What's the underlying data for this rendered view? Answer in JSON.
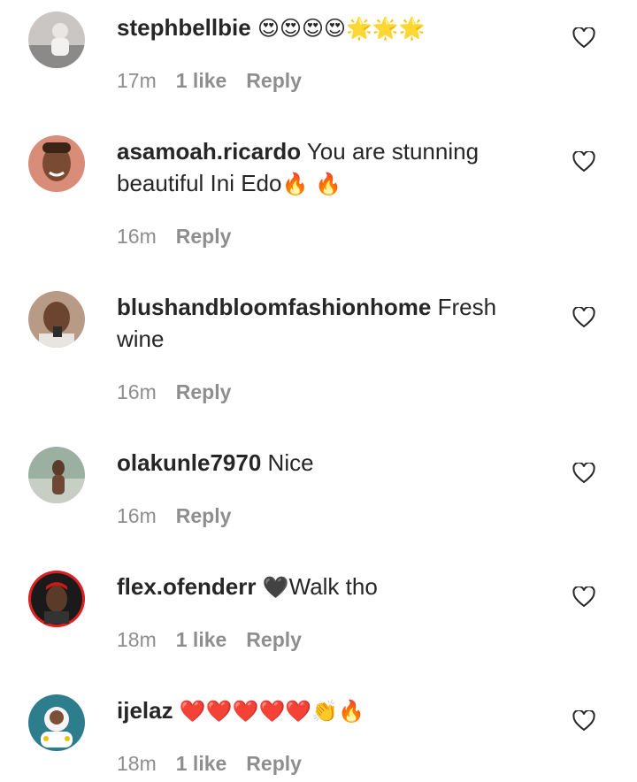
{
  "comments": [
    {
      "username": "stephbellbie",
      "text": "",
      "emoji": "😍😍😍😍🌟🌟🌟",
      "time": "17m",
      "likes": "1 like",
      "reply": "Reply"
    },
    {
      "username": "asamoah.ricardo",
      "text": " You are stunning beautiful Ini Edo",
      "emoji": "🔥 🔥",
      "time": "16m",
      "likes": "",
      "reply": "Reply"
    },
    {
      "username": "blushandbloomfashionhome",
      "text": " Fresh wine",
      "emoji": "",
      "time": "16m",
      "likes": "",
      "reply": "Reply"
    },
    {
      "username": "olakunle7970",
      "text": " Nice",
      "emoji": "",
      "time": "16m",
      "likes": "",
      "reply": "Reply"
    },
    {
      "username": "flex.ofenderr",
      "text": "Walk tho",
      "emoji": "🖤",
      "time": "18m",
      "likes": "1 like",
      "reply": "Reply"
    },
    {
      "username": "ijelaz",
      "text": "",
      "emoji": "❤️❤️❤️❤️❤️👏🔥",
      "time": "18m",
      "likes": "1 like",
      "reply": "Reply"
    }
  ],
  "icons": {
    "like": "heart-outline-icon",
    "avatar": "profile-photo"
  },
  "colors": {
    "text": "#262626",
    "meta": "#8e8e8e",
    "avatar_ring": "#e02020"
  }
}
